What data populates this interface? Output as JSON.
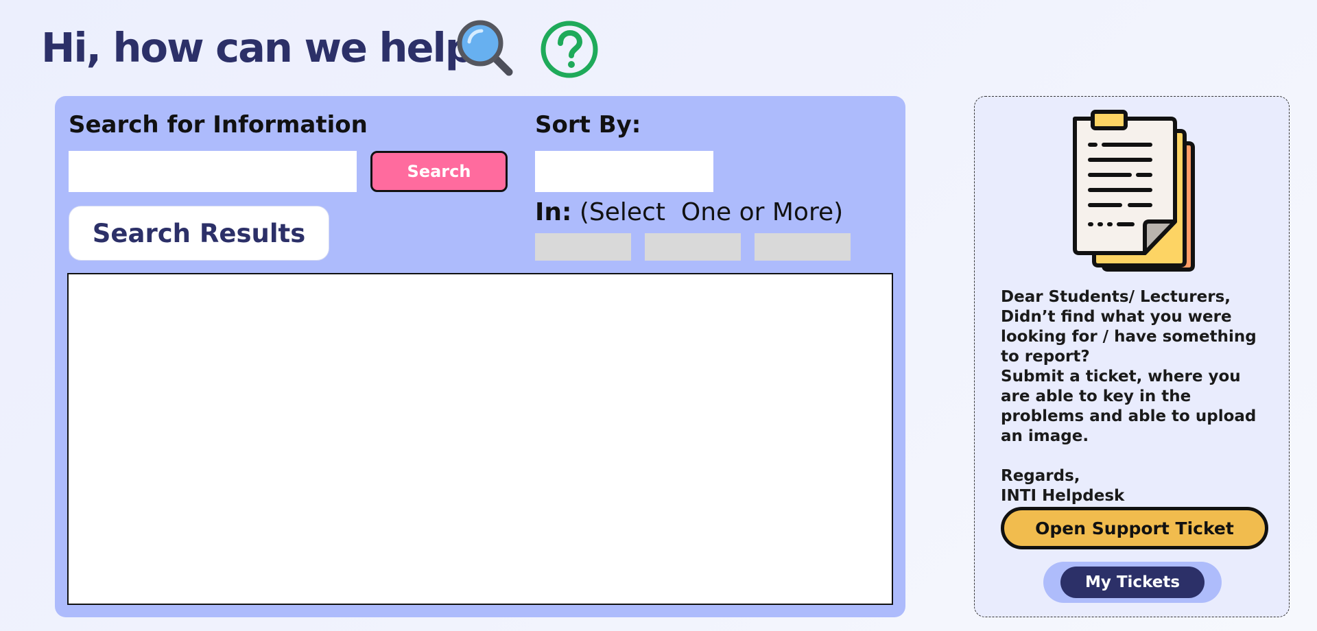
{
  "header": {
    "title": "Hi, how can we help?",
    "magnifier_icon": "magnifying-glass-icon",
    "help_icon": "question-circle-icon"
  },
  "search": {
    "label": "Search for Information",
    "input_value": "",
    "button_label": "Search",
    "results_tab_label": "Search Results"
  },
  "sort": {
    "label": "Sort By:",
    "value": "",
    "in_label": "In:",
    "in_hint": " (Select  One or More)",
    "options": [
      "",
      "",
      ""
    ]
  },
  "info_card": {
    "illustration_icon": "documents-icon",
    "message": "Dear Students/ Lecturers,\nDidn’t find what you were looking for / have something to report?\nSubmit a ticket, where you are able to key in the problems and able to upload an image.\n\nRegards,\nINTI Helpdesk",
    "open_ticket_label": "Open Support Ticket",
    "my_tickets_label": "My Tickets"
  },
  "colors": {
    "title": "#2c3068",
    "panel_bg": "#adbbfc",
    "search_button": "#ff6b9e",
    "ticket_button": "#f1bc4e",
    "my_tickets_button": "#2c3068",
    "help_icon": "#1faa5a"
  }
}
